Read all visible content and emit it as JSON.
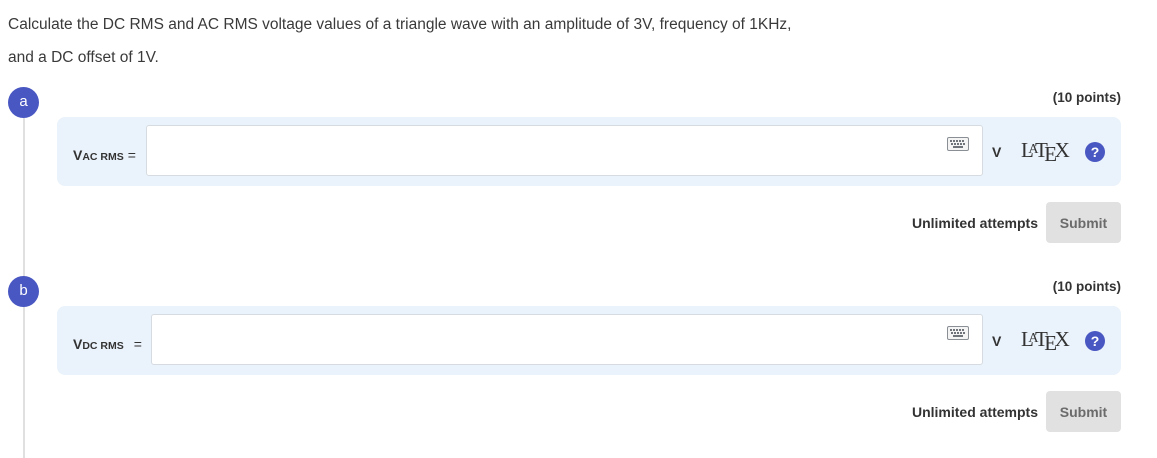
{
  "question": {
    "text": "Calculate the DC RMS and AC RMS voltage values of a triangle wave with an amplitude of 3V, frequency of 1KHz, and a DC offset of 1V."
  },
  "parts": [
    {
      "badge": "a",
      "points": "(10 points)",
      "var_main": "V",
      "var_sub": "AC RMS",
      "equals": "=",
      "input_value": "",
      "unit": "V",
      "attempts": "Unlimited attempts",
      "submit_label": "Submit"
    },
    {
      "badge": "b",
      "points": "(10 points)",
      "var_main": "V",
      "var_sub": "DC RMS",
      "equals": "=",
      "input_value": "",
      "unit": "V",
      "attempts": "Unlimited attempts",
      "submit_label": "Submit"
    }
  ],
  "icons": {
    "keyboard": "keyboard-icon",
    "help": "help-icon",
    "latex_logo": "LaTeX"
  },
  "colors": {
    "accent": "#4957c2",
    "answer_bg": "#eaf2fb",
    "submit_bg": "#e1e1e1"
  }
}
